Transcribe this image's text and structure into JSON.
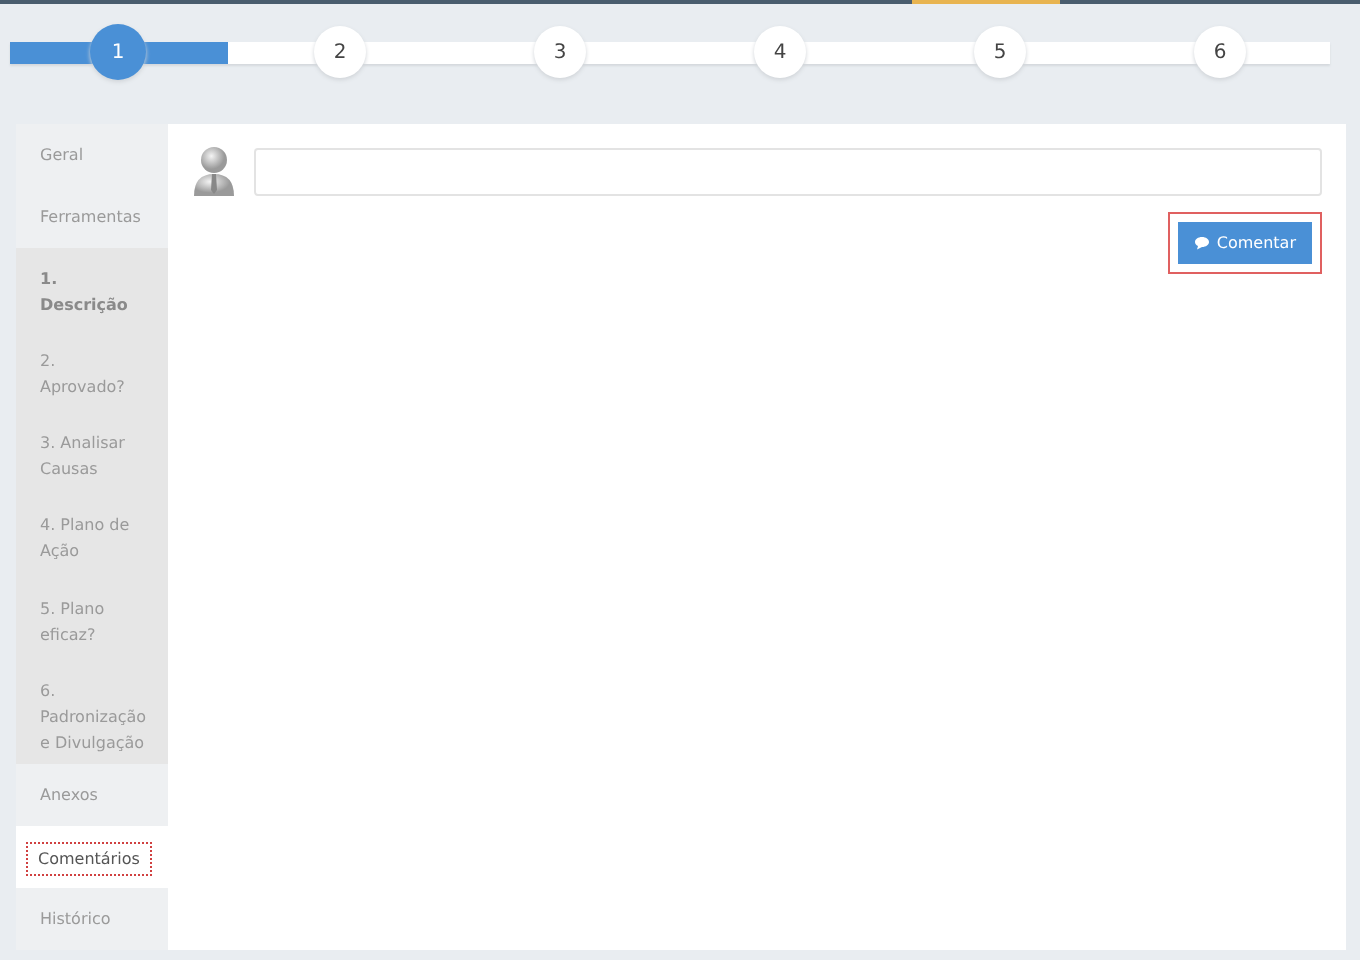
{
  "stepper": {
    "level": 0.165,
    "steps": [
      {
        "label": "1",
        "selected": true
      },
      {
        "label": "2",
        "selected": false
      },
      {
        "label": "3",
        "selected": false
      },
      {
        "label": "4",
        "selected": false
      },
      {
        "label": "5",
        "selected": false
      },
      {
        "label": "6",
        "selected": false
      }
    ]
  },
  "sidebar": {
    "items": [
      {
        "label": "Geral",
        "kind": "section",
        "selected": false,
        "current": false
      },
      {
        "label": "Ferramentas",
        "kind": "section",
        "selected": false,
        "current": false
      },
      {
        "label": "1. Descrição",
        "kind": "step",
        "selected": false,
        "current": true
      },
      {
        "label": "2. Aprovado?",
        "kind": "step",
        "selected": false,
        "current": false
      },
      {
        "label": "3. Analisar Causas",
        "kind": "step",
        "selected": false,
        "current": false
      },
      {
        "label": "4. Plano de Ação",
        "kind": "step",
        "selected": false,
        "current": false
      },
      {
        "label": "5. Plano eficaz?",
        "kind": "step",
        "selected": false,
        "current": false
      },
      {
        "label": "6. Padronização e Divulgação",
        "kind": "step",
        "selected": false,
        "current": false
      },
      {
        "label": "Anexos",
        "kind": "section",
        "selected": false,
        "current": false
      },
      {
        "label": "Comentários",
        "kind": "section",
        "selected": true,
        "current": false
      },
      {
        "label": "Histórico",
        "kind": "section",
        "selected": false,
        "current": false
      }
    ]
  },
  "comment": {
    "button": "Comentar"
  }
}
